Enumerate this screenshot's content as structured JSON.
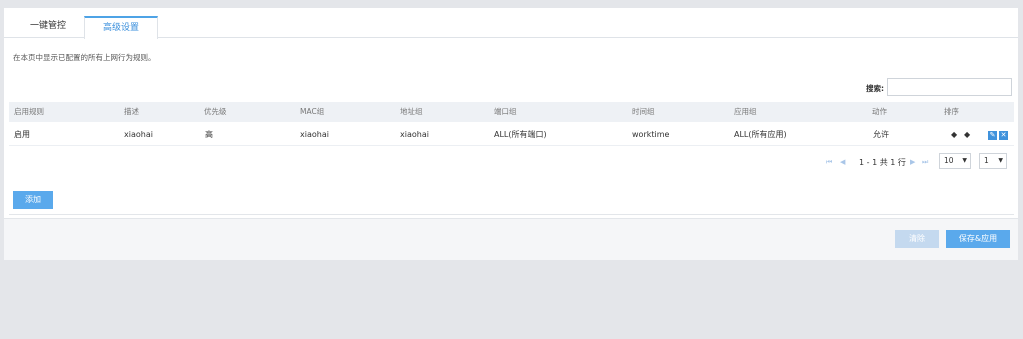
{
  "tabs": [
    {
      "label": "一键管控"
    },
    {
      "label": "高级设置"
    }
  ],
  "description": "在本页中显示已配置的所有上网行为规则。",
  "search": {
    "label": "搜索:",
    "value": "",
    "placeholder": ""
  },
  "table": {
    "headers": [
      "启用规则",
      "描述",
      "优先级",
      "MAC组",
      "地址组",
      "端口组",
      "时间组",
      "应用组",
      "动作",
      "排序"
    ],
    "rows": [
      {
        "enabled": "启用",
        "desc": "xiaohai",
        "priority": "高",
        "mac": "xiaohai",
        "addr": "xiaohai",
        "port": "ALL(所有端口)",
        "time": "worktime",
        "app": "ALL(所有应用)",
        "action": "允许"
      }
    ]
  },
  "pagination": {
    "range": "1 - 1 共 1 行",
    "page_size": "10",
    "page": "1"
  },
  "buttons": {
    "add": "添加",
    "clear": "清除",
    "save_apply": "保存&应用"
  },
  "colors": {
    "accent": "#5aa9ec",
    "tab_active": "#3a8fdc",
    "arrow": "#67b346"
  }
}
